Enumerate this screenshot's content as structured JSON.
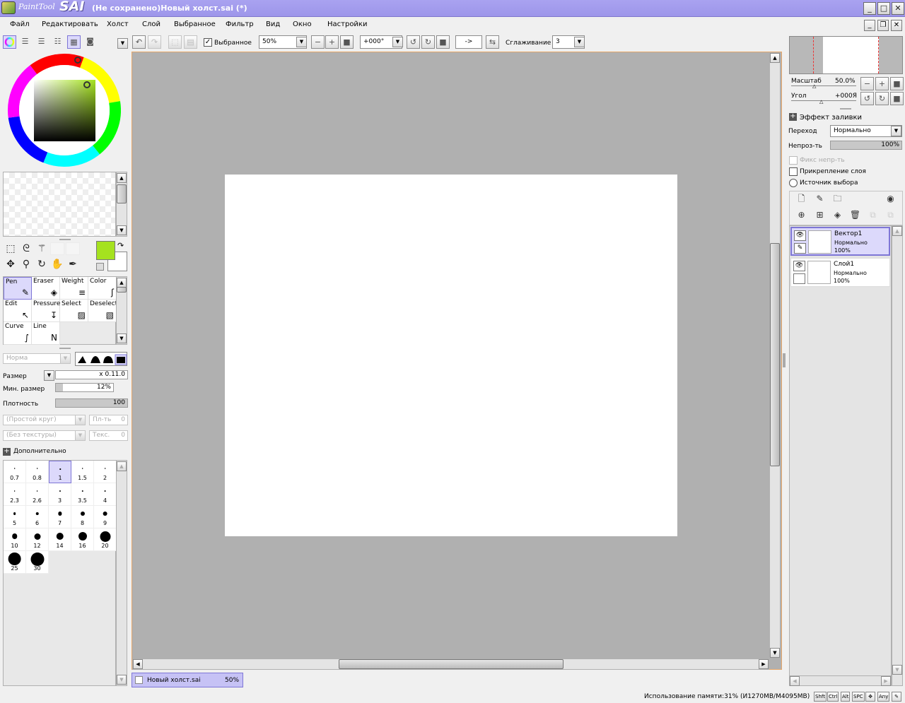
{
  "window": {
    "app_name_left": "PaintTool",
    "app_name_right": "SAI",
    "title": "(Не сохранено)Новый холст.sai (*)"
  },
  "menu": [
    "Файл",
    "Редактировать",
    "Холст",
    "Слой",
    "Выбранное",
    "Фильтр",
    "Вид",
    "Окно",
    "Настройки"
  ],
  "toolbar": {
    "selection_label": "Выбранное",
    "selection_checked": true,
    "zoom": "50%",
    "angle": "+000°",
    "arrow": "->",
    "smoothing_label": "Сглаживание",
    "smoothing_value": "3"
  },
  "tools": {
    "brushes": [
      {
        "label": "Pen",
        "icon": "pen-icon"
      },
      {
        "label": "Eraser",
        "icon": "eraser-icon"
      },
      {
        "label": "Weight",
        "icon": "weight-icon"
      },
      {
        "label": "Color",
        "icon": "color-icon"
      },
      {
        "label": "Edit",
        "icon": "edit-icon"
      },
      {
        "label": "Pressure",
        "icon": "pressure-icon"
      },
      {
        "label": "Select",
        "icon": "select-icon"
      },
      {
        "label": "Deselect",
        "icon": "deselect-icon"
      },
      {
        "label": "Curve",
        "icon": "curve-icon"
      },
      {
        "label": "Line",
        "icon": "line-icon"
      }
    ],
    "primary_color": "#a5e21f",
    "secondary_color": "#ffffff"
  },
  "brush_settings": {
    "mode": "Норма",
    "size_label": "Размер",
    "size_multiplier": "x 0.1",
    "size_value": "1.0",
    "min_size_label": "Мин. размер",
    "min_size_value": "12%",
    "density_label": "Плотность",
    "density_value": "100",
    "shape": "(Простой круг)",
    "shape_amount_label": "Пл-ть",
    "shape_amount_value": "0",
    "texture": "(Без текстуры)",
    "texture_amount_label": "Текс.",
    "texture_amount_value": "0",
    "advanced_label": "Дополнительно"
  },
  "brush_sizes": [
    "0.7",
    "0.8",
    "1",
    "1.5",
    "2",
    "2.3",
    "2.6",
    "3",
    "3.5",
    "4",
    "5",
    "6",
    "7",
    "8",
    "9",
    "10",
    "12",
    "14",
    "16",
    "20",
    "25",
    "30"
  ],
  "navigator": {
    "zoom_label": "Масштаб",
    "zoom_value": "50.0%",
    "angle_label": "Угол",
    "angle_value": "+000Я"
  },
  "layer_props": {
    "fill_effect_label": "Эффект заливки",
    "blend_label": "Переход",
    "blend_value": "Нормально",
    "opacity_label": "Непроз-ть",
    "opacity_value": "100%",
    "preserve_opacity_label": "Фикс непр-ть",
    "clipping_label": "Прикрепление слоя",
    "selection_source_label": "Источник выбора"
  },
  "layers": [
    {
      "name": "Вектор1",
      "mode": "Нормально",
      "opacity": "100%",
      "selected": true
    },
    {
      "name": "Слой1",
      "mode": "Нормально",
      "opacity": "100%",
      "selected": false
    }
  ],
  "doc_tab": {
    "name": "Новый холст.sai",
    "zoom": "50%"
  },
  "status": {
    "memory": "Использование памяти:31% (И1270MB/M4095MB)",
    "keys": [
      "Shft",
      "Ctrl",
      "Alt",
      "SPC",
      "Any"
    ]
  }
}
